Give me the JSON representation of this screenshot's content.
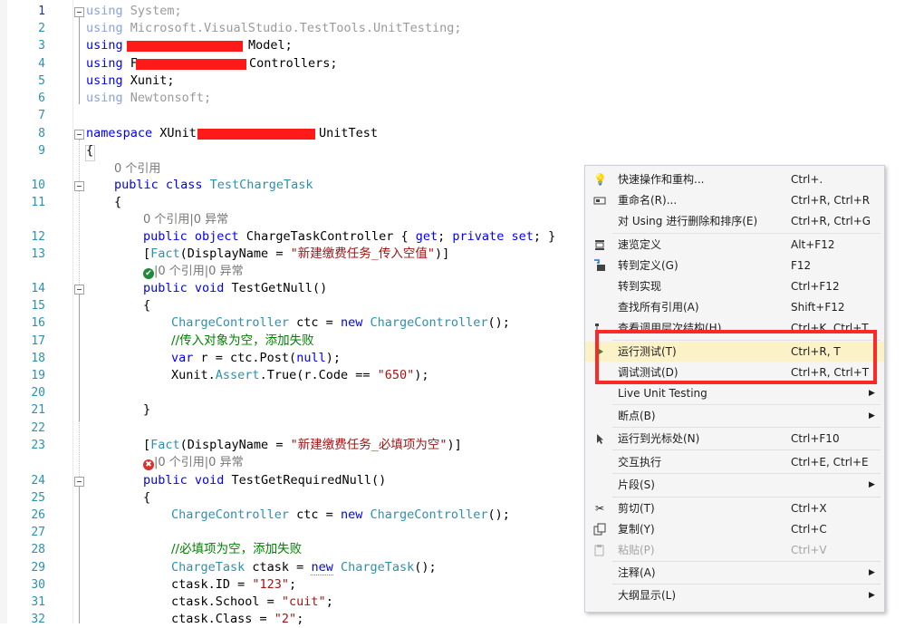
{
  "line_numbers": [
    "1",
    "2",
    "3",
    "4",
    "5",
    "6",
    "7",
    "8",
    "9",
    "10",
    "11",
    "12",
    "13",
    "14",
    "15",
    "16",
    "17",
    "18",
    "19",
    "20",
    "21",
    "22",
    "23",
    "24",
    "25",
    "26",
    "27",
    "28",
    "29",
    "30",
    "31",
    "32"
  ],
  "code": {
    "l1_kw": "using",
    "l1_rest": " System;",
    "l2_kw": "using",
    "l2_rest": " Microsoft.VisualStudio.TestTools.UnitTesting;",
    "l3_kw": "using",
    "l3_rest": "Model;",
    "l4_kw": "using",
    "l4_pre": " F",
    "l4_rest": "Controllers;",
    "l5_kw": "using",
    "l5_rest": " Xunit;",
    "l6_kw": "using",
    "l6_rest": " Newtonsoft;",
    "l8_kw": "namespace",
    "l8_pre": " XUnit.",
    "l8_rest": "UnitTest",
    "l9": "{",
    "lens_class": "0 个引用",
    "l10_kw": "public class ",
    "l10_type": "TestChargeTask",
    "l11": "{",
    "lens_prop": "0 个引用|0 异常",
    "l12_kw1": "public ",
    "l12_kw2": "object",
    "l12_mid": " ChargeTaskController { ",
    "l12_get": "get",
    "l12_semi": "; ",
    "l12_priv": "private set",
    "l12_end": "; }",
    "l13_open": "[",
    "l13_attr": "Fact",
    "l13_mid": "(DisplayName = ",
    "l13_str": "\"新建缴费任务_传入空值\"",
    "l13_end": ")]",
    "lens_m1": "|0 个引用|0 异常",
    "l14_kw": "public void",
    "l14_rest": " TestGetNull()",
    "l15": "{",
    "l16_type": "ChargeController",
    "l16_mid": " ctc = ",
    "l16_kw": "new",
    "l16_type2": " ChargeController",
    "l16_end": "();",
    "l17_cmt": "//传入对象为空，添加失败",
    "l18_kw": "var",
    "l18_mid": " r = ctc.Post(",
    "l18_null": "null",
    "l18_end": ");",
    "l19_a": "Xunit.",
    "l19_type": "Assert",
    "l19_b": ".True(r.Code == ",
    "l19_str": "\"650\"",
    "l19_end": ");",
    "l21": "}",
    "l23_open": "[",
    "l23_attr": "Fact",
    "l23_mid": "(DisplayName = ",
    "l23_str": "\"新建缴费任务_必填项为空\"",
    "l23_end": ")]",
    "lens_m2": "|0 个引用|0 异常",
    "l24_kw": "public void",
    "l24_rest": " TestGetRequiredNull()",
    "l25": "{",
    "l26_type": "ChargeController",
    "l26_mid": " ctc = ",
    "l26_kw": "new",
    "l26_type2": " ChargeController",
    "l26_end": "();",
    "l28_cmt": "//必填项为空，添加失败",
    "l29_type": "ChargeTask",
    "l29_mid": " ctask = ",
    "l29_kw": "new",
    "l29_type2": " ChargeTask",
    "l29_end": "();",
    "l30_a": "ctask.ID = ",
    "l30_str": "\"123\"",
    "l30_end": ";",
    "l31_a": "ctask.School = ",
    "l31_str": "\"cuit\"",
    "l31_end": ";",
    "l32_a": "ctask.Class = ",
    "l32_str": "\"2\"",
    "l32_end": ";"
  },
  "context_menu": {
    "items": [
      {
        "label": "快速操作和重构...",
        "shortcut": "Ctrl+.",
        "icon": "lightbulb-icon"
      },
      {
        "label": "重命名(R)...",
        "shortcut": "Ctrl+R, Ctrl+R",
        "icon": "rename-icon"
      },
      {
        "label": "对 Using 进行删除和排序(E)",
        "shortcut": "Ctrl+R, Ctrl+G"
      },
      {
        "label": "速览定义",
        "shortcut": "Alt+F12",
        "icon": "peek-definition-icon"
      },
      {
        "label": "转到定义(G)",
        "shortcut": "F12",
        "icon": "goto-definition-icon"
      },
      {
        "label": "转到实现",
        "shortcut": "Ctrl+F12"
      },
      {
        "label": "查找所有引用(A)",
        "shortcut": "Shift+F12"
      },
      {
        "label": "查看调用层次结构(H)",
        "shortcut": "Ctrl+K, Ctrl+T",
        "icon": "call-hierarchy-icon"
      },
      {
        "label": "运行测试(T)",
        "shortcut": "Ctrl+R, T",
        "icon": "run-test-icon"
      },
      {
        "label": "调试测试(D)",
        "shortcut": "Ctrl+R, Ctrl+T"
      },
      {
        "label": "Live Unit Testing",
        "submenu": true
      },
      {
        "label": "断点(B)",
        "submenu": true
      },
      {
        "label": "运行到光标处(N)",
        "shortcut": "Ctrl+F10",
        "icon": "run-to-cursor-icon"
      },
      {
        "label": "交互执行",
        "shortcut": "Ctrl+E, Ctrl+E"
      },
      {
        "label": "片段(S)",
        "submenu": true
      },
      {
        "label": "剪切(T)",
        "shortcut": "Ctrl+X",
        "icon": "cut-icon"
      },
      {
        "label": "复制(Y)",
        "shortcut": "Ctrl+C",
        "icon": "copy-icon"
      },
      {
        "label": "粘贴(P)",
        "shortcut": "Ctrl+V",
        "icon": "paste-icon",
        "disabled": true
      },
      {
        "label": "注释(A)",
        "submenu": true
      },
      {
        "label": "大纲显示(L)",
        "submenu": true
      }
    ]
  },
  "colors": {
    "highlight_box": "#ff2828",
    "hover_row": "#fcf2c8"
  }
}
